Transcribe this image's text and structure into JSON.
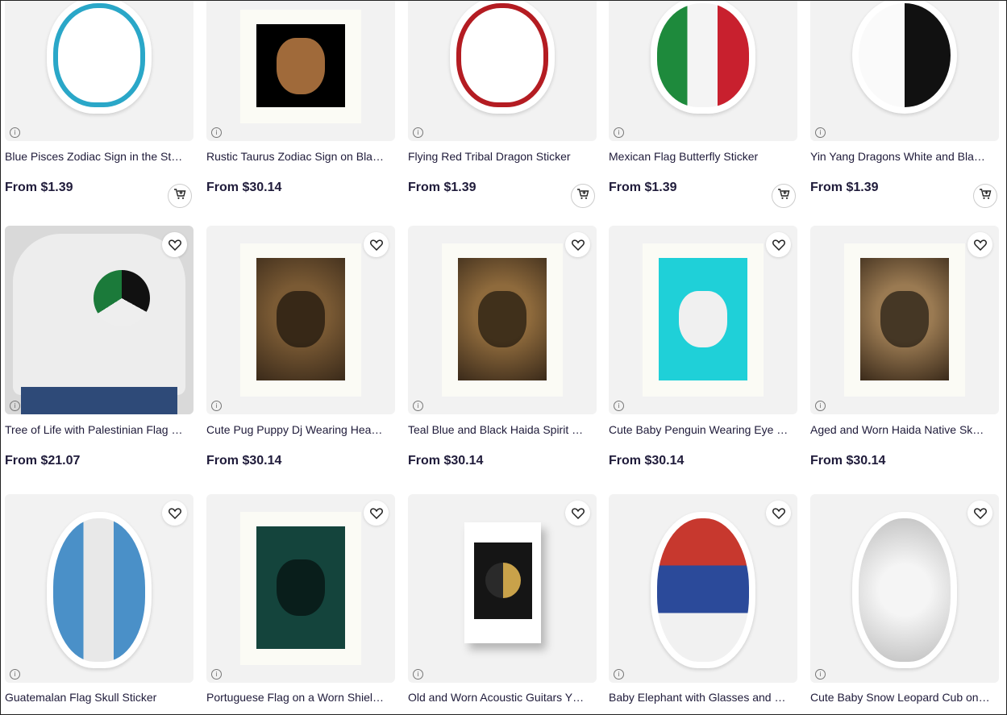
{
  "info_glyph": "i",
  "row1": [
    {
      "title": "Blue Pisces Zodiac Sign in the St…",
      "price": "From $1.39",
      "cart": true,
      "image": "pisces-sticker",
      "color": "#2aa7c8"
    },
    {
      "title": "Rustic Taurus Zodiac Sign on Bla…",
      "price": "From $30.14",
      "cart": false,
      "image": "taurus-print",
      "color": "#b0784a"
    },
    {
      "title": "Flying Red Tribal Dragon Sticker",
      "price": "From $1.39",
      "cart": true,
      "image": "dragon-sticker",
      "color": "#b41c22"
    },
    {
      "title": "Mexican Flag Butterfly Sticker",
      "price": "From $1.39",
      "cart": true,
      "image": "butterfly-sticker",
      "color": "#1e8a3c"
    },
    {
      "title": "Yin Yang Dragons White and Bla…",
      "price": "From $1.39",
      "cart": true,
      "image": "yinyang-sticker",
      "color": "#111111"
    }
  ],
  "row2": [
    {
      "title": "Tree of Life with Palestinian Flag …",
      "price": "From $21.07",
      "image": "tshirt",
      "color": "#e4e4e4"
    },
    {
      "title": "Cute Pug Puppy Dj Wearing Hea…",
      "price": "From $30.14",
      "image": "pug-print",
      "color": "#7a5a34"
    },
    {
      "title": "Teal Blue and Black Haida Spirit …",
      "price": "From $30.14",
      "image": "orca-print",
      "color": "#8e6a3c"
    },
    {
      "title": "Cute Baby Penguin Wearing Eye …",
      "price": "From $30.14",
      "image": "penguin-print",
      "color": "#1fd0d8"
    },
    {
      "title": "Aged and Worn Haida Native Sk…",
      "price": "From $30.14",
      "image": "skull-print",
      "color": "#9a7a52"
    }
  ],
  "row3": [
    {
      "title": "Guatemalan Flag Skull Sticker",
      "image": "skull-sticker",
      "color": "#5e7c8e"
    },
    {
      "title": "Portuguese Flag on a Worn Shiel…",
      "image": "shield-print",
      "color": "#14443c"
    },
    {
      "title": "Old and Worn Acoustic Guitars Y…",
      "image": "guitar-card",
      "color": "#151515"
    },
    {
      "title": "Baby Elephant with Glasses and …",
      "image": "elephant-sticker",
      "color": "#c7382e"
    },
    {
      "title": "Cute Baby Snow Leopard Cub on…",
      "image": "leopard-sticker",
      "color": "#bdbdbd"
    }
  ]
}
